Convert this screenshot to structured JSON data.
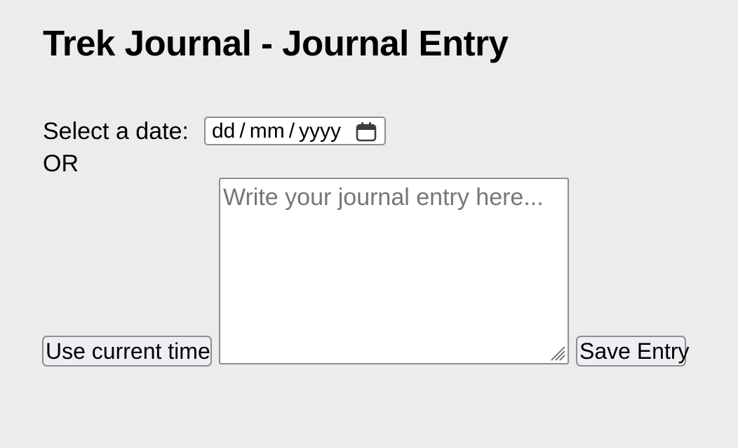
{
  "page": {
    "title": "Trek Journal - Journal Entry"
  },
  "date_picker": {
    "label": "Select a date:",
    "day_placeholder": "dd",
    "month_placeholder": "mm",
    "year_placeholder": "yyyy",
    "separator": "/",
    "icon": "calendar-icon"
  },
  "or_text": "OR",
  "use_current_time_button": {
    "label": "Use current time"
  },
  "journal_entry": {
    "placeholder": "Write your journal entry here...",
    "value": ""
  },
  "save_button": {
    "label": "Save Entry"
  },
  "colors": {
    "background": "#edebec",
    "border": "#8d8d92",
    "button_bg": "#efeff3",
    "placeholder": "#767676"
  }
}
